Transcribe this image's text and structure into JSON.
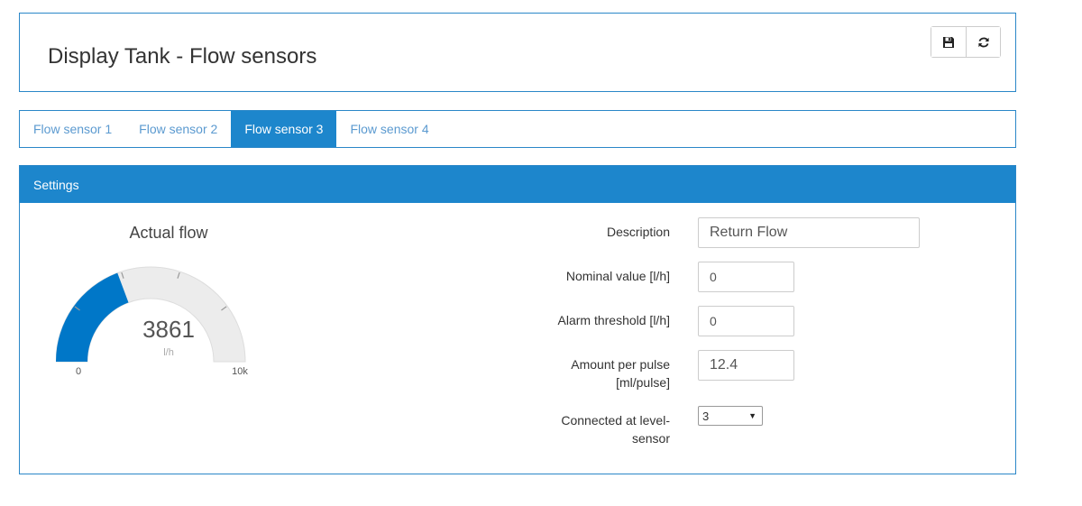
{
  "header": {
    "title": "Display Tank - Flow sensors"
  },
  "toolbar": {
    "save_icon": "floppy-disk-icon",
    "refresh_icon": "refresh-icon"
  },
  "tabs": [
    {
      "label": "Flow sensor 1",
      "active": false
    },
    {
      "label": "Flow sensor 2",
      "active": false
    },
    {
      "label": "Flow sensor 3",
      "active": true
    },
    {
      "label": "Flow sensor 4",
      "active": false
    }
  ],
  "settings": {
    "header": "Settings",
    "gauge": {
      "title": "Actual flow",
      "value": 3861,
      "value_text": "3861",
      "unit": "l/h",
      "min_label": "0",
      "max_label": "10k",
      "min": 0,
      "max": 10000,
      "fill_color": "#0077c8",
      "track_color": "#ececec"
    },
    "form": {
      "description": {
        "label": "Description",
        "value": "Return Flow"
      },
      "nominal": {
        "label": "Nominal value [l/h]",
        "value": "0"
      },
      "alarm": {
        "label": "Alarm threshold [l/h]",
        "value": "0"
      },
      "amount": {
        "label_line1": "Amount per pulse",
        "label_line2": "[ml/pulse]",
        "value": "12.4"
      },
      "connected": {
        "label_line1": "Connected at level-",
        "label_line2": "sensor",
        "value": "3"
      }
    }
  }
}
